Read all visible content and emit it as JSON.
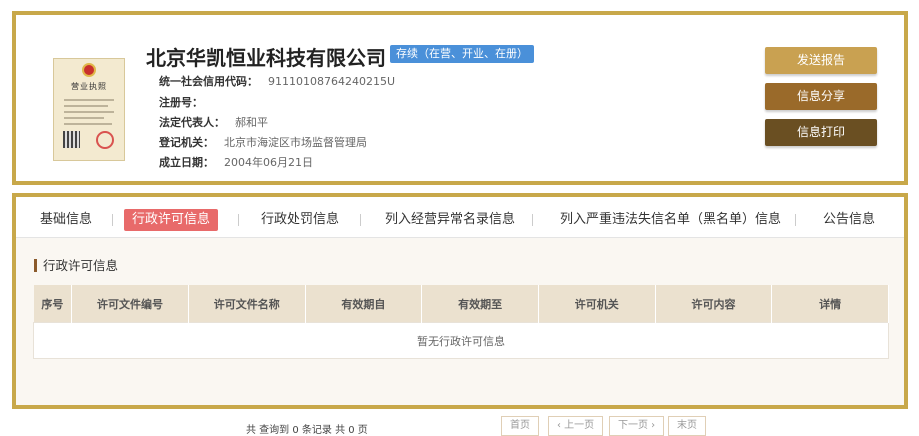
{
  "company": {
    "name": "北京华凯恒业科技有限公司",
    "status": "存续（在营、开业、在册）",
    "license_title": "营业执照"
  },
  "info": [
    {
      "label": "统一社会信用代码：",
      "value": "91110108764240215U"
    },
    {
      "label": "注册号：",
      "value": ""
    },
    {
      "label": "法定代表人：",
      "value": "郝和平"
    },
    {
      "label": "登记机关：",
      "value": "北京市海淀区市场监督管理局"
    },
    {
      "label": "成立日期：",
      "value": "2004年06月21日"
    }
  ],
  "actions": {
    "send_report": "发送报告",
    "share": "信息分享",
    "print": "信息打印"
  },
  "tabs": [
    "基础信息",
    "行政许可信息",
    "行政处罚信息",
    "列入经营异常名录信息",
    "列入严重违法失信名单（黑名单）信息",
    "公告信息"
  ],
  "active_tab": "行政许可信息",
  "section": {
    "title": "行政许可信息",
    "columns": [
      "序号",
      "许可文件编号",
      "许可文件名称",
      "有效期自",
      "有效期至",
      "许可机关",
      "许可内容",
      "详情"
    ],
    "empty_text": "暂无行政许可信息"
  },
  "pagination": {
    "summary": "共 查询到 0 条记录 共 0 页",
    "first": "首页",
    "prev": "‹ 上一页",
    "next": "下一页 ›",
    "last": "末页"
  },
  "colors": {
    "frame": "#c8a84a",
    "status_badge": "#4a90d9",
    "active_tab": "#e86a6a",
    "btn_send": "#c9a151",
    "btn_share": "#9a6a2a",
    "btn_print": "#6a4f22"
  }
}
